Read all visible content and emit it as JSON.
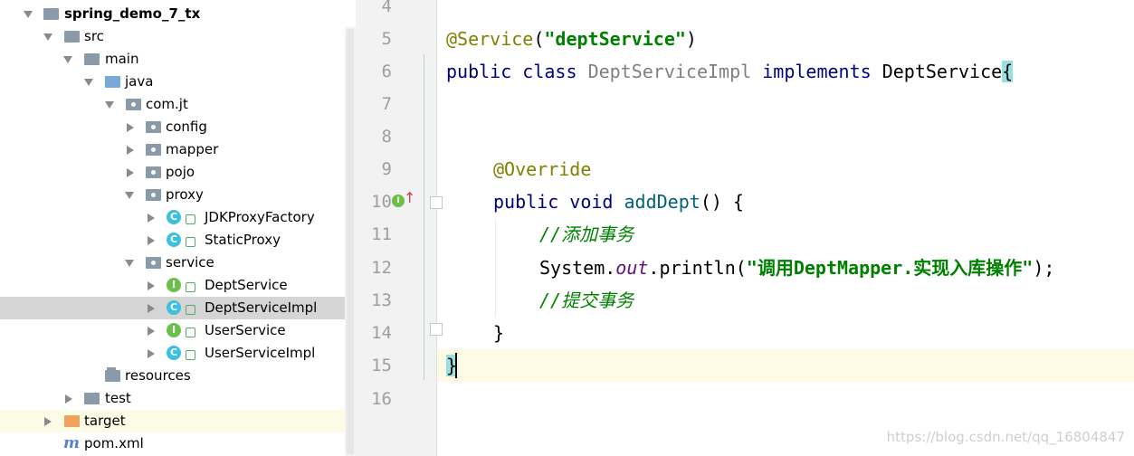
{
  "tree": {
    "items": [
      {
        "label": "spring_demo_7_tx",
        "bold": true
      },
      {
        "label": "src"
      },
      {
        "label": "main"
      },
      {
        "label": "java"
      },
      {
        "label": "com.jt"
      },
      {
        "label": "config"
      },
      {
        "label": "mapper"
      },
      {
        "label": "pojo"
      },
      {
        "label": "proxy"
      },
      {
        "label": "JDKProxyFactory",
        "icon_letter": "C"
      },
      {
        "label": "StaticProxy",
        "icon_letter": "C"
      },
      {
        "label": "service"
      },
      {
        "label": "DeptService",
        "icon_letter": "I"
      },
      {
        "label": "DeptServiceImpl",
        "icon_letter": "C"
      },
      {
        "label": "UserService",
        "icon_letter": "I"
      },
      {
        "label": "UserServiceImpl",
        "icon_letter": "C"
      },
      {
        "label": "resources"
      },
      {
        "label": "test"
      },
      {
        "label": "target"
      },
      {
        "label": "pom.xml",
        "icon_letter": "m"
      }
    ],
    "selected": "DeptServiceImpl"
  },
  "editor": {
    "line_numbers": [
      "4",
      "5",
      "6",
      "7",
      "8",
      "9",
      "10",
      "11",
      "12",
      "13",
      "14",
      "15",
      "16"
    ],
    "tokens": {
      "service_annotation": "@Service",
      "paren_open": "(",
      "service_name": "\"deptService\"",
      "paren_close": ")",
      "kw_public": "public",
      "kw_class": "class",
      "class_name": "DeptServiceImpl",
      "kw_implements": "implements",
      "interface_name": "DeptService",
      "brace_open": "{",
      "override": "@Override",
      "kw_void": "void",
      "method_name": "addDept",
      "method_parens": "() {",
      "comment_1": "//添加事务",
      "system": "System.",
      "out": "out",
      "println": ".println(",
      "print_string": "\"调用DeptMapper.实现入库操作\"",
      "println_end": ");",
      "comment_2": "//提交事务",
      "method_close": "}",
      "class_close": "}"
    },
    "gutter_icon_letter": "I",
    "gutter_arrow": "↑"
  },
  "watermark": "https://blog.csdn.net/qq_16804847",
  "colors": {
    "keyword": "#000080",
    "annotation": "#808000",
    "string": "#008000",
    "comment": "#008000",
    "static_field": "#660e7a",
    "selection": "#d5d5d5",
    "caret_line": "#fdfbe6"
  }
}
